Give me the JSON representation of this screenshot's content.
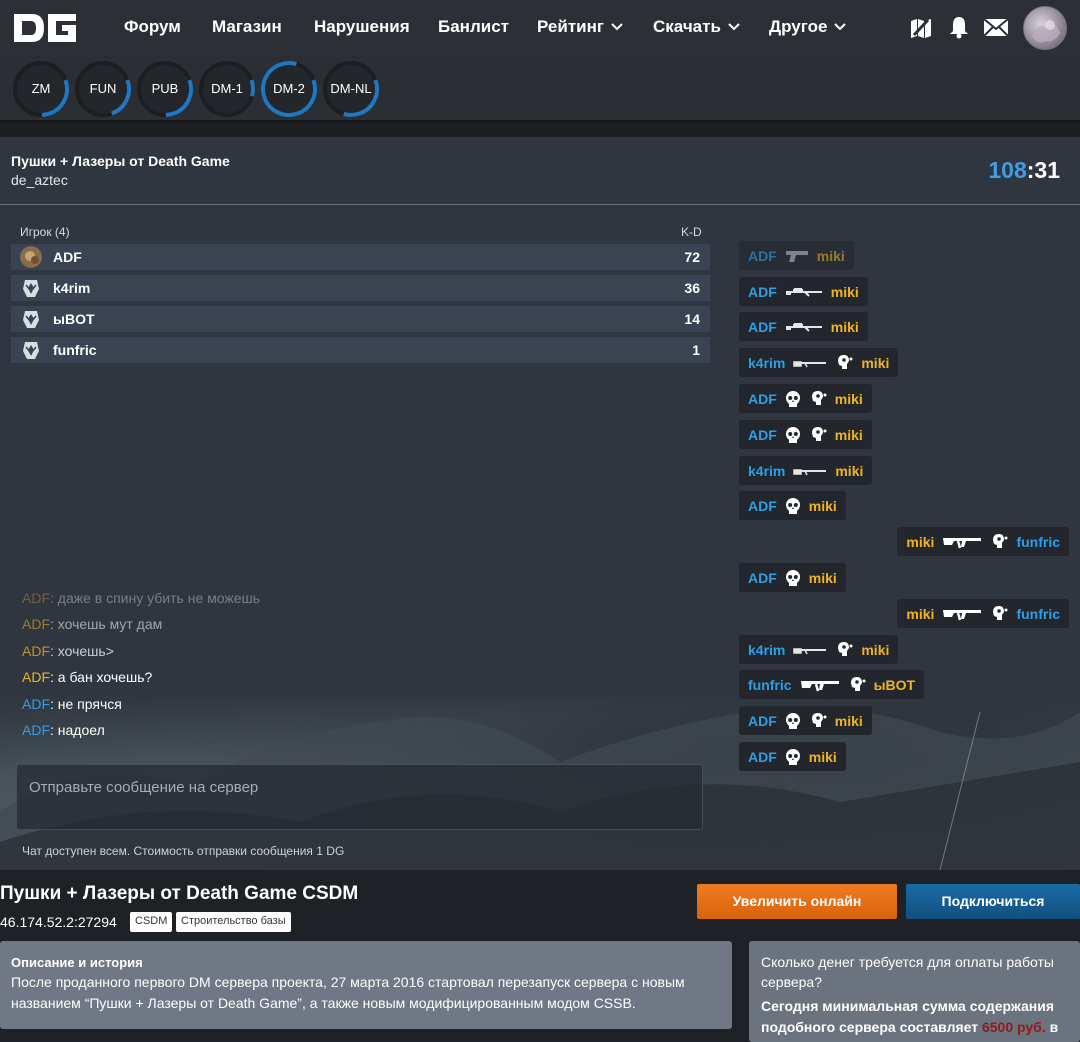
{
  "nav": {
    "logo": "DG",
    "items": [
      {
        "label": "Форум",
        "dropdown": false
      },
      {
        "label": "Магазин",
        "dropdown": false
      },
      {
        "label": "Нарушения",
        "dropdown": false
      },
      {
        "label": "Банлист",
        "dropdown": false
      },
      {
        "label": "Рейтинг",
        "dropdown": true
      },
      {
        "label": "Скачать",
        "dropdown": true
      },
      {
        "label": "Другое",
        "dropdown": true
      }
    ],
    "icons": [
      "compass-icon",
      "bell-icon",
      "mail-icon",
      "avatar"
    ]
  },
  "servers": [
    {
      "label": "ZM",
      "fill": 0.3
    },
    {
      "label": "FUN",
      "fill": 0.25
    },
    {
      "label": "PUB",
      "fill": 0.3
    },
    {
      "label": "DM-1",
      "fill": 0.1
    },
    {
      "label": "DM-2",
      "fill": 0.85
    },
    {
      "label": "DM-NL",
      "fill": 0.35
    }
  ],
  "server": {
    "name": "Пушки + Лазеры от Death Game",
    "map": "de_aztec",
    "timer_min": "108",
    "timer_sep": ":",
    "timer_sec": "31"
  },
  "players": {
    "header_player": "Игрок (4)",
    "header_kd": "K-D",
    "rows": [
      {
        "name": "ADF",
        "kd": "72"
      },
      {
        "name": "k4rim",
        "kd": "36"
      },
      {
        "name": "ыBOT",
        "kd": "14"
      },
      {
        "name": "funfric",
        "kd": "1"
      }
    ]
  },
  "killfeed": [
    {
      "killer": "ADF",
      "weapon": "pistol",
      "hs": false,
      "victim": "miki"
    },
    {
      "killer": "ADF",
      "weapon": "sniper",
      "hs": false,
      "victim": "miki"
    },
    {
      "killer": "ADF",
      "weapon": "sniper",
      "hs": false,
      "victim": "miki"
    },
    {
      "killer": "k4rim",
      "weapon": "rifle",
      "hs": true,
      "victim": "miki"
    },
    {
      "killer": "ADF",
      "weapon": "skull",
      "hs": true,
      "victim": "miki"
    },
    {
      "killer": "ADF",
      "weapon": "skull",
      "hs": true,
      "victim": "miki"
    },
    {
      "killer": "k4rim",
      "weapon": "rifle",
      "hs": false,
      "victim": "miki"
    },
    {
      "killer": "ADF",
      "weapon": "skull",
      "hs": false,
      "victim": "miki"
    },
    {
      "killer": "miki",
      "weapon": "ak",
      "hs": true,
      "victim": "funfric"
    },
    {
      "killer": "ADF",
      "weapon": "skull",
      "hs": false,
      "victim": "miki"
    },
    {
      "killer": "miki",
      "weapon": "ak",
      "hs": true,
      "victim": "funfric"
    },
    {
      "killer": "k4rim",
      "weapon": "rifle",
      "hs": true,
      "victim": "miki"
    },
    {
      "killer": "funfric",
      "weapon": "ak",
      "hs": true,
      "victim": "ыBOT"
    },
    {
      "killer": "ADF",
      "weapon": "skull",
      "hs": true,
      "victim": "miki"
    },
    {
      "killer": "ADF",
      "weapon": "skull",
      "hs": false,
      "victim": "miki"
    }
  ],
  "chat": {
    "messages": [
      {
        "author": "ADF",
        "text": ": даже в спину убить не можешь"
      },
      {
        "author": "ADF",
        "text": ": хочешь мут дам"
      },
      {
        "author": "ADF",
        "text": ": хочешь>"
      },
      {
        "author": "ADF",
        "text": ": а бан хочешь?"
      },
      {
        "author": "ADF",
        "text": ": не прячся"
      },
      {
        "author": "ADF",
        "text": ": надоел"
      }
    ],
    "placeholder": "Отправьте сообщение на сервер",
    "note": "Чат доступен всем. Стоимость отправки сообщения 1 DG"
  },
  "footer": {
    "title": "Пушки + Лазеры от Death Game CSDM",
    "ip": "46.174.52.2:27294",
    "tags": [
      "CSDM",
      "Строительство базы"
    ],
    "btn_boost": "Увеличить онлайн",
    "btn_connect": "Подключиться",
    "desc_heading": "Описание и история",
    "desc_text": "После проданного первого DM сервера проекта, 27 марта 2016 стартовал перезапуск сервера с новым названием “Пушки + Лазеры от Death Game”, а также новым модифицированным модом CSSB.",
    "cost_question": "Сколько денег требуется для оплаты работы сервера?",
    "cost_answer_pre": "Сегодня минимальная сумма содержания подобного сервера составляет ",
    "cost_amount": "6500 руб.",
    "cost_answer_post": " в"
  }
}
